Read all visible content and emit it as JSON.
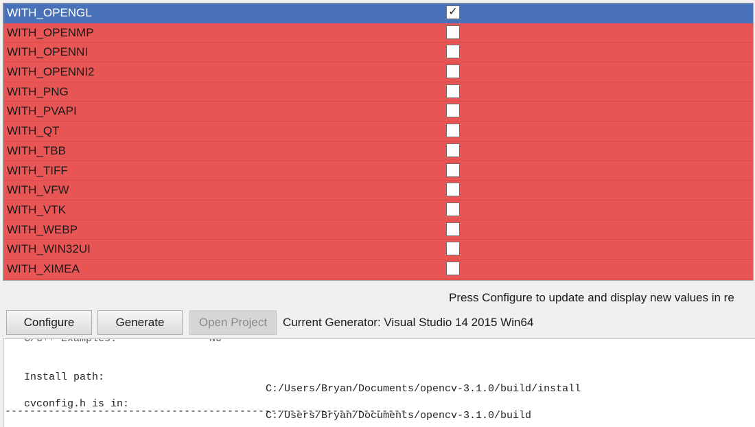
{
  "cache_entries": [
    {
      "name": "WITH_OPENGL",
      "checked": true
    },
    {
      "name": "WITH_OPENMP",
      "checked": false
    },
    {
      "name": "WITH_OPENNI",
      "checked": false
    },
    {
      "name": "WITH_OPENNI2",
      "checked": false
    },
    {
      "name": "WITH_PNG",
      "checked": false
    },
    {
      "name": "WITH_PVAPI",
      "checked": false
    },
    {
      "name": "WITH_QT",
      "checked": false
    },
    {
      "name": "WITH_TBB",
      "checked": false
    },
    {
      "name": "WITH_TIFF",
      "checked": false
    },
    {
      "name": "WITH_VFW",
      "checked": false
    },
    {
      "name": "WITH_VTK",
      "checked": false
    },
    {
      "name": "WITH_WEBP",
      "checked": false
    },
    {
      "name": "WITH_WIN32UI",
      "checked": false
    },
    {
      "name": "WITH_XIMEA",
      "checked": false
    }
  ],
  "check_glyph": "✓",
  "colors": {
    "new_entry_bg": "#e85555",
    "selected_bg": "#4a72b8"
  },
  "hint": "Press Configure to update and display new values in re",
  "toolbar": {
    "configure_label": "Configure",
    "generate_label": "Generate",
    "open_project_label": "Open Project",
    "generator_text": "Current Generator: Visual Studio 14 2015 Win64"
  },
  "log": {
    "cut_off_line": "C/C++ Examples:               NO",
    "install_label": "Install path:",
    "install_value": "C:/Users/Bryan/Documents/opencv-3.1.0/build/install",
    "cvconfig_label": "cvconfig.h is in:",
    "cvconfig_value": "C:/Users/Bryan/Documents/opencv-3.1.0/build",
    "rule": "-----------------------------------------------------------------"
  }
}
